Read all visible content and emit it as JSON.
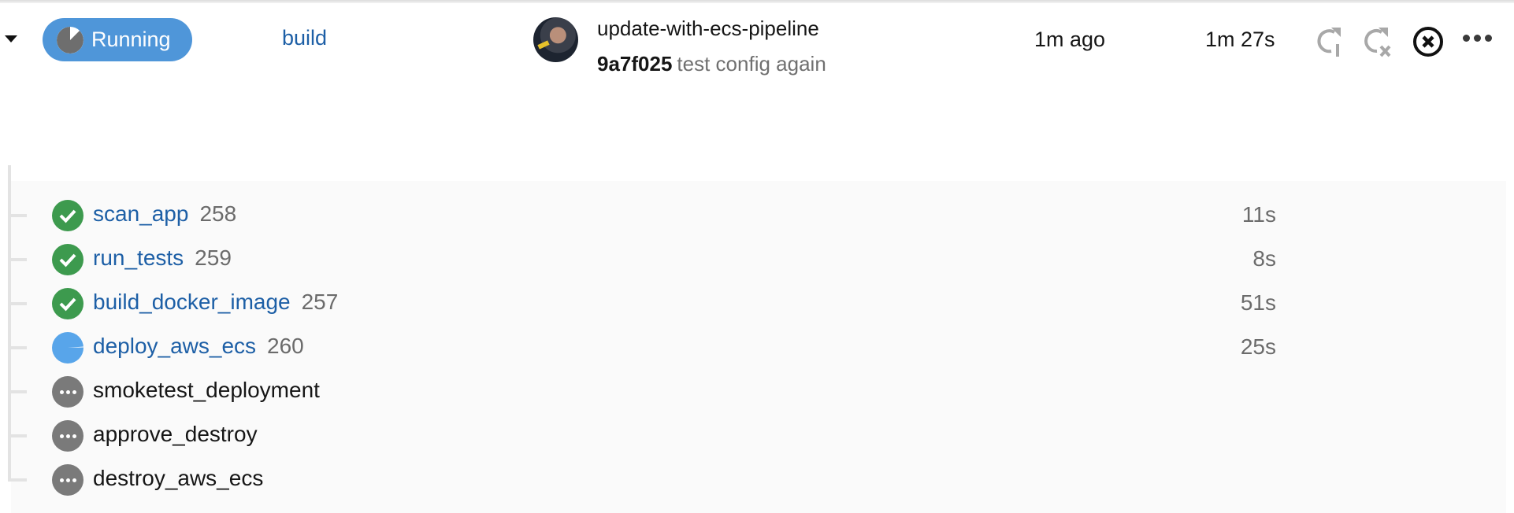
{
  "pipeline": {
    "status": "Running",
    "workflow": "build",
    "branch": "update-with-ecs-pipeline",
    "commit_sha": "9a7f025",
    "commit_message": "test config again",
    "started": "1m ago",
    "duration": "1m 27s",
    "actions": {
      "expand": "caret-down-icon",
      "rerun": "rerun-icon",
      "rerun_failed": "rerun-failed-icon",
      "cancel": "cancel-icon",
      "more": "more-icon"
    }
  },
  "jobs": [
    {
      "name": "scan_app",
      "number": "258",
      "duration": "11s",
      "status": "success"
    },
    {
      "name": "run_tests",
      "number": "259",
      "duration": "8s",
      "status": "success"
    },
    {
      "name": "build_docker_image",
      "number": "257",
      "duration": "51s",
      "status": "success"
    },
    {
      "name": "deploy_aws_ecs",
      "number": "260",
      "duration": "25s",
      "status": "running"
    },
    {
      "name": "smoketest_deployment",
      "number": "",
      "duration": "",
      "status": "queued"
    },
    {
      "name": "approve_destroy",
      "number": "",
      "duration": "",
      "status": "queued"
    },
    {
      "name": "destroy_aws_ecs",
      "number": "",
      "duration": "",
      "status": "queued"
    }
  ],
  "colors": {
    "running": "#4f96d9",
    "success": "#3d9a4e",
    "queued": "#7a7a7a",
    "link": "#1d5fa6"
  }
}
